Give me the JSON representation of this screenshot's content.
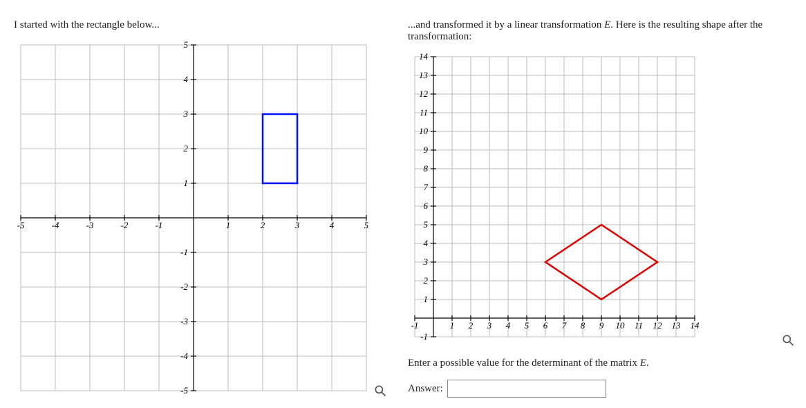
{
  "left": {
    "prompt": "I started with the rectangle below..."
  },
  "right": {
    "prompt_pre": "...and transformed it by a linear transformation ",
    "prompt_var": "E",
    "prompt_post": ". Here is the resulting shape after the transformation:",
    "question_pre": "Enter a possible value for the determinant of the matrix ",
    "question_var": "E",
    "question_post": ".",
    "answer_label": "Answer:",
    "answer_value": ""
  },
  "chart_data": [
    {
      "type": "shape-on-grid",
      "name": "original-rectangle",
      "xlim": [
        -5,
        5
      ],
      "ylim": [
        -5,
        5
      ],
      "xticks": [
        -5,
        -4,
        -3,
        -2,
        -1,
        1,
        2,
        3,
        4,
        5
      ],
      "yticks": [
        -5,
        -4,
        -3,
        -2,
        -1,
        1,
        2,
        3,
        4,
        5
      ],
      "shape": {
        "color": "blue",
        "vertices": [
          [
            2,
            1
          ],
          [
            3,
            1
          ],
          [
            3,
            3
          ],
          [
            2,
            3
          ]
        ]
      }
    },
    {
      "type": "shape-on-grid",
      "name": "transformed-parallelogram",
      "xlim": [
        -1,
        14
      ],
      "ylim": [
        -1,
        14
      ],
      "xticks": [
        -1,
        1,
        2,
        3,
        4,
        5,
        6,
        7,
        8,
        9,
        10,
        11,
        12,
        13,
        14
      ],
      "yticks": [
        -1,
        1,
        2,
        3,
        4,
        5,
        6,
        7,
        8,
        9,
        10,
        11,
        12,
        13,
        14
      ],
      "shape": {
        "color": "red",
        "vertices": [
          [
            6,
            3
          ],
          [
            9,
            1
          ],
          [
            12,
            3
          ],
          [
            9,
            5
          ]
        ]
      }
    }
  ]
}
